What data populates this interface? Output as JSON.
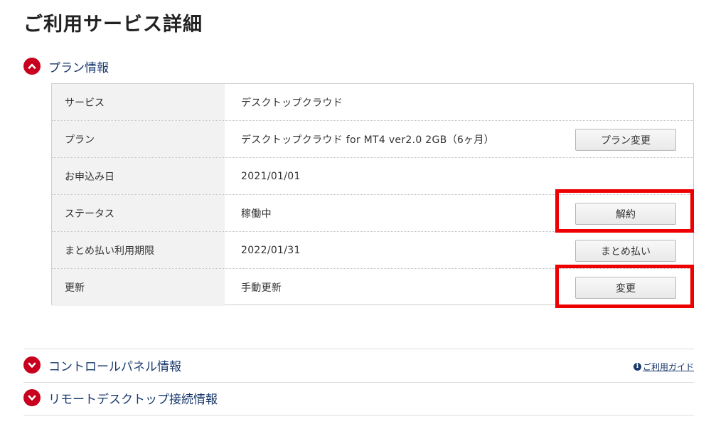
{
  "page": {
    "title": "ご利用サービス詳細"
  },
  "sections": {
    "plan": {
      "label": "プラン情報",
      "expanded": true,
      "icon": "chevron-up-icon"
    },
    "control_panel": {
      "label": "コントロールパネル情報",
      "expanded": false,
      "icon": "chevron-down-icon"
    },
    "remote_desktop": {
      "label": "リモートデスクトップ接続情報",
      "expanded": false,
      "icon": "chevron-down-icon"
    }
  },
  "plan_table": {
    "rows": [
      {
        "label": "サービス",
        "value": "デスクトップクラウド",
        "button": ""
      },
      {
        "label": "プラン",
        "value": "デスクトップクラウド for MT4 ver2.0 2GB（6ヶ月）",
        "button": "プラン変更"
      },
      {
        "label": "お申込み日",
        "value": "2021/01/01",
        "button": ""
      },
      {
        "label": "ステータス",
        "value": "稼働中",
        "button": "解約"
      },
      {
        "label": "まとめ払い利用期限",
        "value": "2022/01/31",
        "button": "まとめ払い"
      },
      {
        "label": "更新",
        "value": "手動更新",
        "button": "変更"
      }
    ]
  },
  "guide": {
    "icon_text": "i",
    "label": "ご利用ガイド"
  },
  "colors": {
    "accent_red": "#c8001e",
    "highlight_red": "#ee0000",
    "link_navy": "#1a3a6e"
  }
}
